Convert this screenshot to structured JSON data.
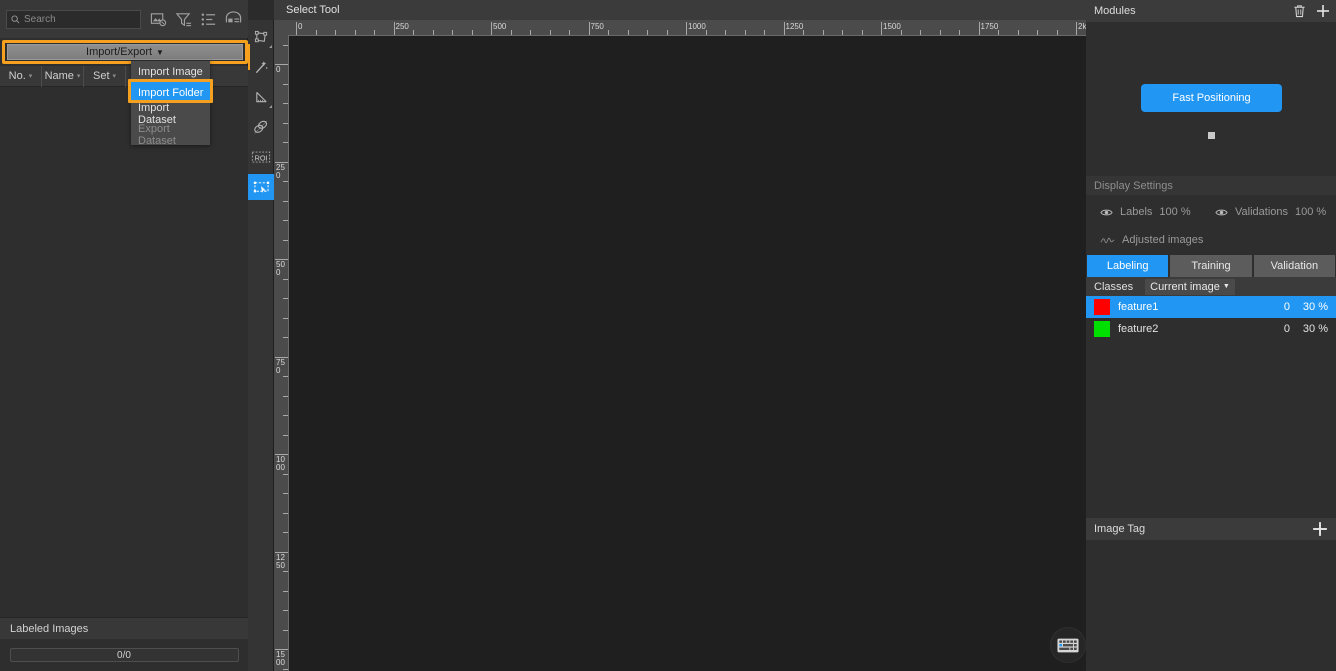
{
  "left_panel": {
    "search": {
      "placeholder": "Search",
      "value": ""
    },
    "header_icons": [
      "image-filter-icon",
      "funnel-filter-icon",
      "list-view-icon",
      "gallery-view-icon"
    ],
    "import_export_button": "Import/Export",
    "import_export_caret": "▼",
    "table_columns": [
      {
        "label": "No.",
        "sort": "▾"
      },
      {
        "label": "Name",
        "sort": "▾"
      },
      {
        "label": "Set",
        "sort": "▾"
      },
      {
        "label": "",
        "sort": "▾"
      }
    ],
    "labeled_images_label": "Labeled Images",
    "progress_text": "0/0"
  },
  "dropdown": {
    "items": [
      {
        "label": "Import Image",
        "state": "normal"
      },
      {
        "label": "Import Folder",
        "state": "selected"
      },
      {
        "label": "Import Dataset",
        "state": "normal"
      },
      {
        "label": "Export Dataset",
        "state": "disabled"
      }
    ]
  },
  "toolbar": {
    "tools": [
      {
        "name": "polygon-tool",
        "active": false,
        "has_corner": true
      },
      {
        "name": "magic-wand-tool",
        "active": false,
        "has_corner": false
      },
      {
        "name": "ruler-tool",
        "active": false,
        "has_corner": true
      },
      {
        "name": "eraser-tool",
        "active": false,
        "has_corner": false
      },
      {
        "name": "roi-tool",
        "active": false,
        "has_corner": false,
        "text": "ROI"
      },
      {
        "name": "select-tool",
        "active": true,
        "has_corner": false
      }
    ]
  },
  "canvas": {
    "tool_title": "Select Tool",
    "ruler_h_labels": [
      "0",
      "250",
      "500",
      "750",
      "1000",
      "1250",
      "1500",
      "1750",
      "2k"
    ],
    "ruler_v_labels": [
      "0",
      "250",
      "500",
      "750",
      "1000",
      "1250",
      "1500"
    ],
    "keyboard_button": "keyboard-shortcuts-icon"
  },
  "right_panel": {
    "modules": {
      "title": "Modules",
      "delete_icon": "trash-icon",
      "add_icon": "plus-icon",
      "node_label": "Fast Positioning"
    },
    "display_settings": {
      "title": "Display Settings",
      "labels": {
        "name": "Labels",
        "value": "100 %"
      },
      "validations": {
        "name": "Validations",
        "value": "100 %"
      },
      "adjusted_images": "Adjusted images"
    },
    "tabs": [
      {
        "label": "Labeling",
        "active": true
      },
      {
        "label": "Training",
        "active": false
      },
      {
        "label": "Validation",
        "active": false
      }
    ],
    "classes_bar": {
      "label": "Classes",
      "scope_selector": "Current image",
      "scope_caret": "▼"
    },
    "classes": [
      {
        "name": "feature1",
        "color": "#ff0000",
        "count": "0",
        "pct": "30 %",
        "selected": true
      },
      {
        "name": "feature2",
        "color": "#00e000",
        "count": "0",
        "pct": "30 %",
        "selected": false
      }
    ],
    "image_tag": {
      "title": "Image Tag",
      "add_icon": "plus-icon"
    }
  },
  "theme": {
    "accent_blue": "#2196f3",
    "highlight_orange": "#f5a01e",
    "panel_bg": "#2e2e2e",
    "canvas_bg": "#1f1f1f"
  }
}
